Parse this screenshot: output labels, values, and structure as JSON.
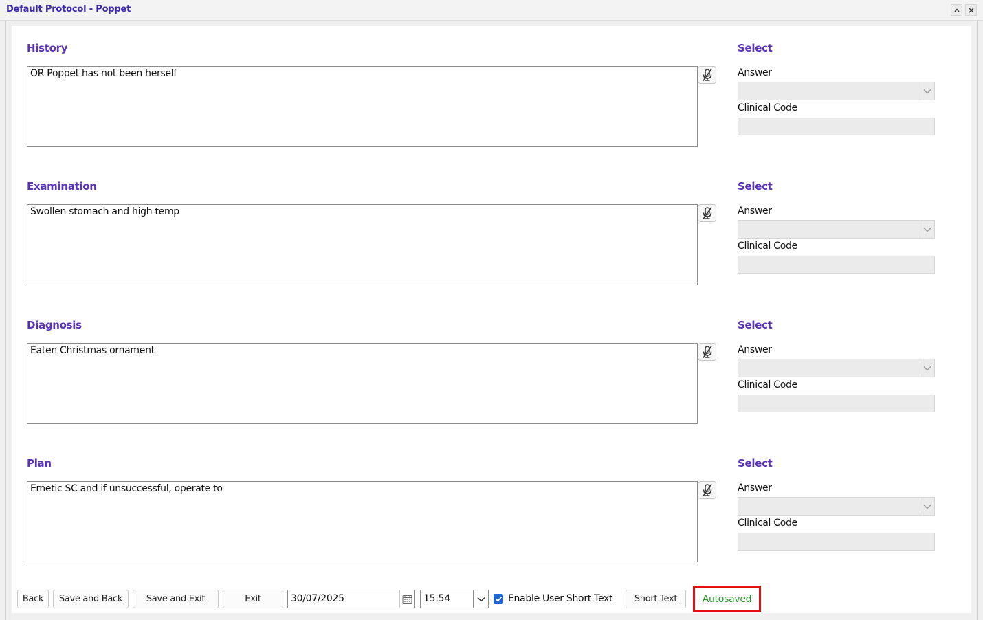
{
  "window": {
    "title": "Default Protocol - Poppet",
    "minimize_icon": "chevron-up-icon",
    "close_icon": "close-icon"
  },
  "sections": [
    {
      "title": "History",
      "text": "OR Poppet has not been herself",
      "select_title": "Select",
      "answer_label": "Answer",
      "answer_value": "",
      "clinical_code_label": "Clinical Code",
      "clinical_code_value": ""
    },
    {
      "title": "Examination",
      "text": "Swollen stomach and high temp",
      "select_title": "Select",
      "answer_label": "Answer",
      "answer_value": "",
      "clinical_code_label": "Clinical Code",
      "clinical_code_value": ""
    },
    {
      "title": "Diagnosis",
      "text": "Eaten Christmas ornament",
      "select_title": "Select",
      "answer_label": "Answer",
      "answer_value": "",
      "clinical_code_label": "Clinical Code",
      "clinical_code_value": ""
    },
    {
      "title": "Plan",
      "text": "Emetic SC and if unsuccessful, operate to",
      "select_title": "Select",
      "answer_label": "Answer",
      "answer_value": "",
      "clinical_code_label": "Clinical Code",
      "clinical_code_value": ""
    }
  ],
  "footer": {
    "back_label": "Back",
    "save_back_label": "Save and Back",
    "save_exit_label": "Save and Exit",
    "exit_label": "Exit",
    "date_value": "30/07/2025",
    "time_value": "15:54",
    "enable_short_text_checked": true,
    "enable_short_text_label": "Enable User Short Text",
    "short_text_label": "Short Text",
    "status_text": "Autosaved"
  },
  "colors": {
    "title_text": "#3d2aa6",
    "section_title": "#5b33b8",
    "status_text": "#1f9a1f",
    "status_highlight": "#e60f0f",
    "checkbox": "#1d66d1"
  }
}
